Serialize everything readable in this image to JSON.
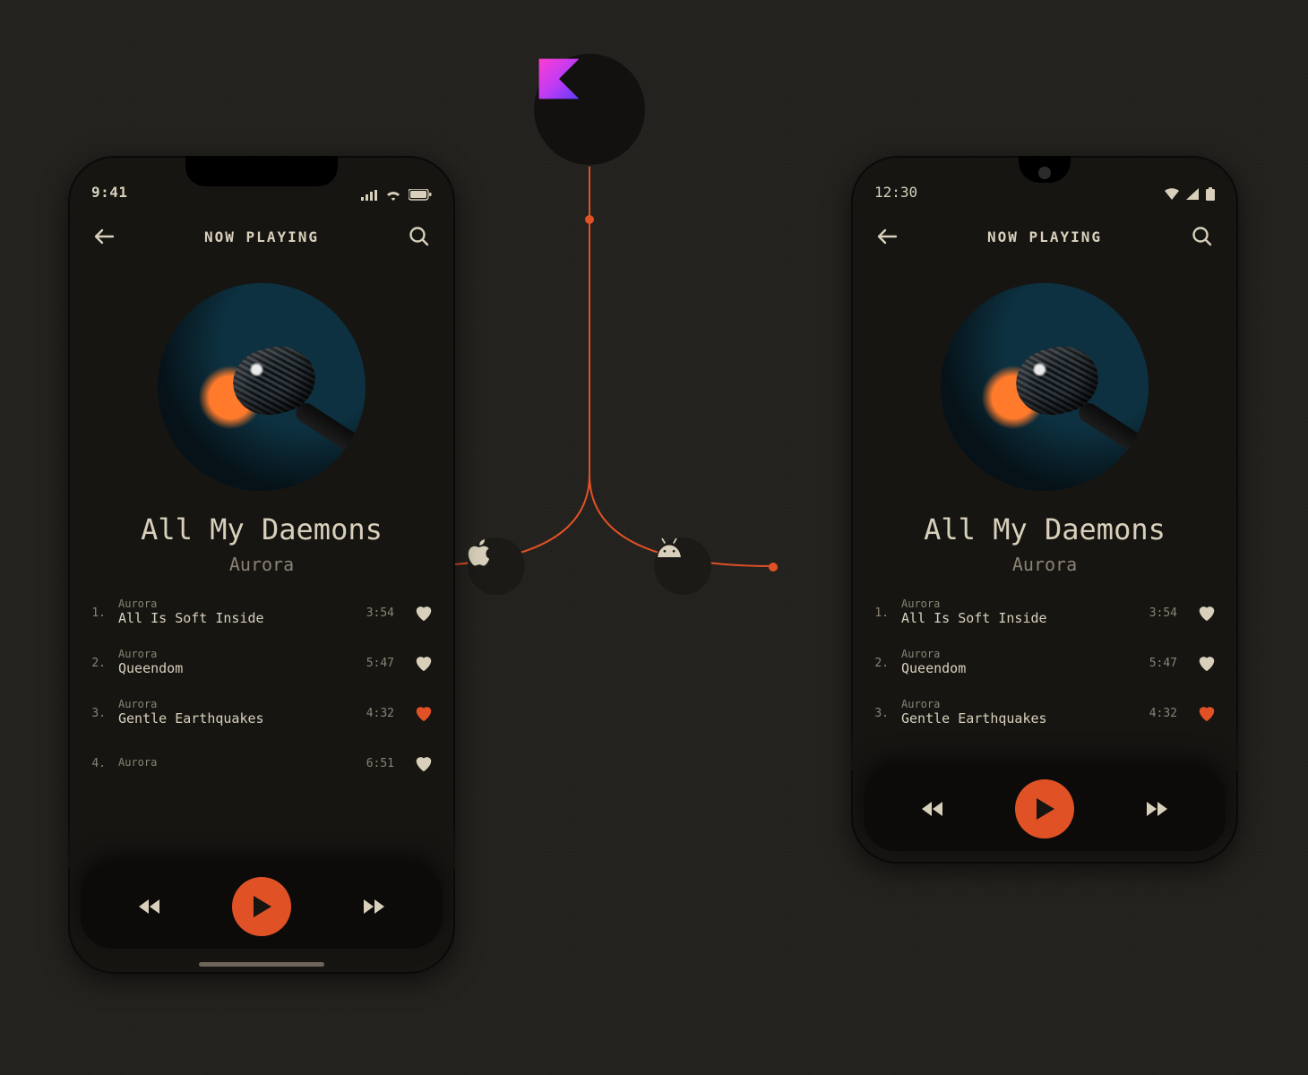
{
  "colors": {
    "accent": "#e15126"
  },
  "header": {
    "title": "NOW PLAYING"
  },
  "now_playing": {
    "title": "All My Daemons",
    "artist": "Aurora"
  },
  "ios": {
    "clock": "9:41"
  },
  "android": {
    "clock": "12:30"
  },
  "tracks": [
    {
      "idx": "1.",
      "artist": "Aurora",
      "name": "All Is Soft Inside",
      "dur": "3:54",
      "fav": false
    },
    {
      "idx": "2.",
      "artist": "Aurora",
      "name": "Queendom",
      "dur": "5:47",
      "fav": false
    },
    {
      "idx": "3.",
      "artist": "Aurora",
      "name": "Gentle Earthquakes",
      "dur": "4:32",
      "fav": true
    },
    {
      "idx": "4.",
      "artist": "Aurora",
      "name": "",
      "dur": "6:51",
      "fav": false
    }
  ],
  "tracks_android": [
    {
      "idx": "1.",
      "artist": "Aurora",
      "name": "All Is Soft Inside",
      "dur": "3:54",
      "fav": false
    },
    {
      "idx": "2.",
      "artist": "Aurora",
      "name": "Queendom",
      "dur": "5:47",
      "fav": false
    },
    {
      "idx": "3.",
      "artist": "Aurora",
      "name": "Gentle Earthquakes",
      "dur": "4:32",
      "fav": true
    }
  ]
}
